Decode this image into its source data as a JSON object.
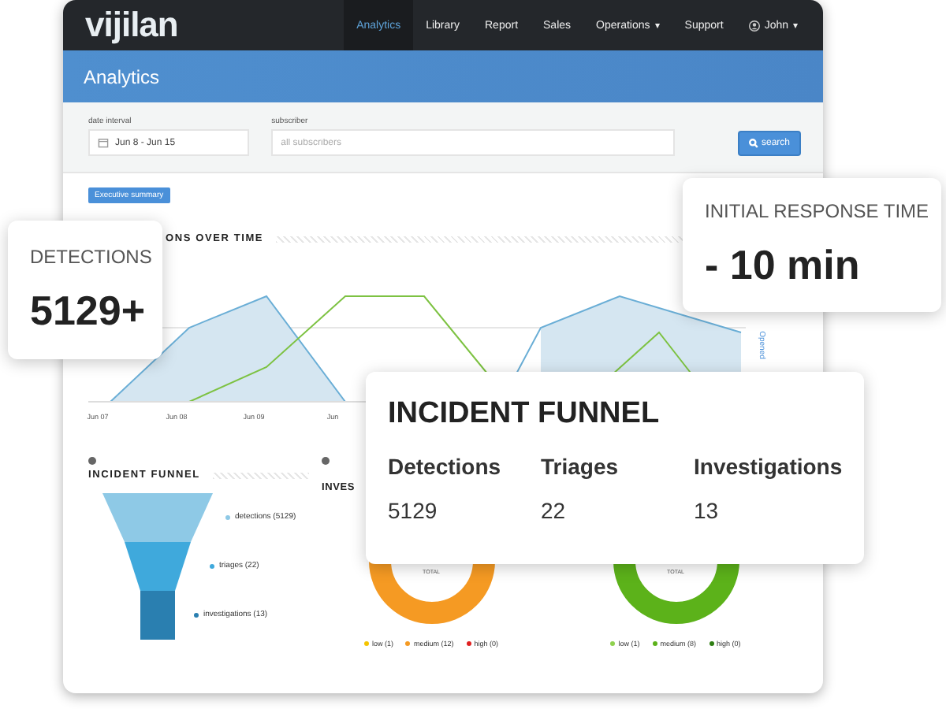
{
  "nav": {
    "logo": "vijilan",
    "items": [
      {
        "label": "Analytics",
        "selected": true
      },
      {
        "label": "Library",
        "selected": false
      },
      {
        "label": "Report",
        "selected": false
      },
      {
        "label": "Sales",
        "selected": false
      },
      {
        "label": "Operations",
        "selected": false,
        "caret": "▾"
      },
      {
        "label": "Support",
        "selected": false
      }
    ],
    "user": {
      "label": "John",
      "caret": "▾"
    }
  },
  "header": {
    "title": "Analytics"
  },
  "filters": {
    "date": {
      "label": "date interval",
      "value": "Jun 8 - Jun 15"
    },
    "subscriber": {
      "label": "subscriber",
      "placeholder": "all subscribers"
    },
    "search_button": "search"
  },
  "summary_button": "Executive summary",
  "timeline": {
    "title": "ONS OVER TIME",
    "x_labels": [
      "Jun 07",
      "Jun 08",
      "Jun 09",
      "Jun"
    ],
    "axis_label": "Opened"
  },
  "funnel": {
    "title": "INCIDENT FUNNEL",
    "stages": [
      {
        "label": "detections (5129)",
        "color": "#8ec9e6"
      },
      {
        "label": "triages (22)",
        "color": "#3fa9dc"
      },
      {
        "label": "investigations (13)",
        "color": "#2a7fb0"
      }
    ]
  },
  "donuts": [
    {
      "title": "INVES",
      "center_label": "TOTAL",
      "color": "#f59a23",
      "legend": [
        {
          "label": "low (1)",
          "color": "#f5c400"
        },
        {
          "label": "medium (12)",
          "color": "#f59a23"
        },
        {
          "label": "high (0)",
          "color": "#e02020"
        }
      ]
    },
    {
      "center_label": "TOTAL",
      "color": "#5cb21a",
      "legend": [
        {
          "label": "low (1)",
          "color": "#8fd14f"
        },
        {
          "label": "medium (8)",
          "color": "#5cb21a"
        },
        {
          "label": "high (0)",
          "color": "#2e7d12"
        }
      ]
    }
  ],
  "cards": [
    {
      "kind": "stat",
      "title": "DETECTIONS",
      "value": "5129+"
    },
    {
      "kind": "stat",
      "title": "INITIAL RESPONSE TIME",
      "value": "- 10 min"
    },
    {
      "kind": "table",
      "title": "INCIDENT FUNNEL",
      "columns": [
        "Detections",
        "Triages",
        "Investigations"
      ],
      "values": [
        "5129",
        "22",
        "13"
      ]
    }
  ]
}
